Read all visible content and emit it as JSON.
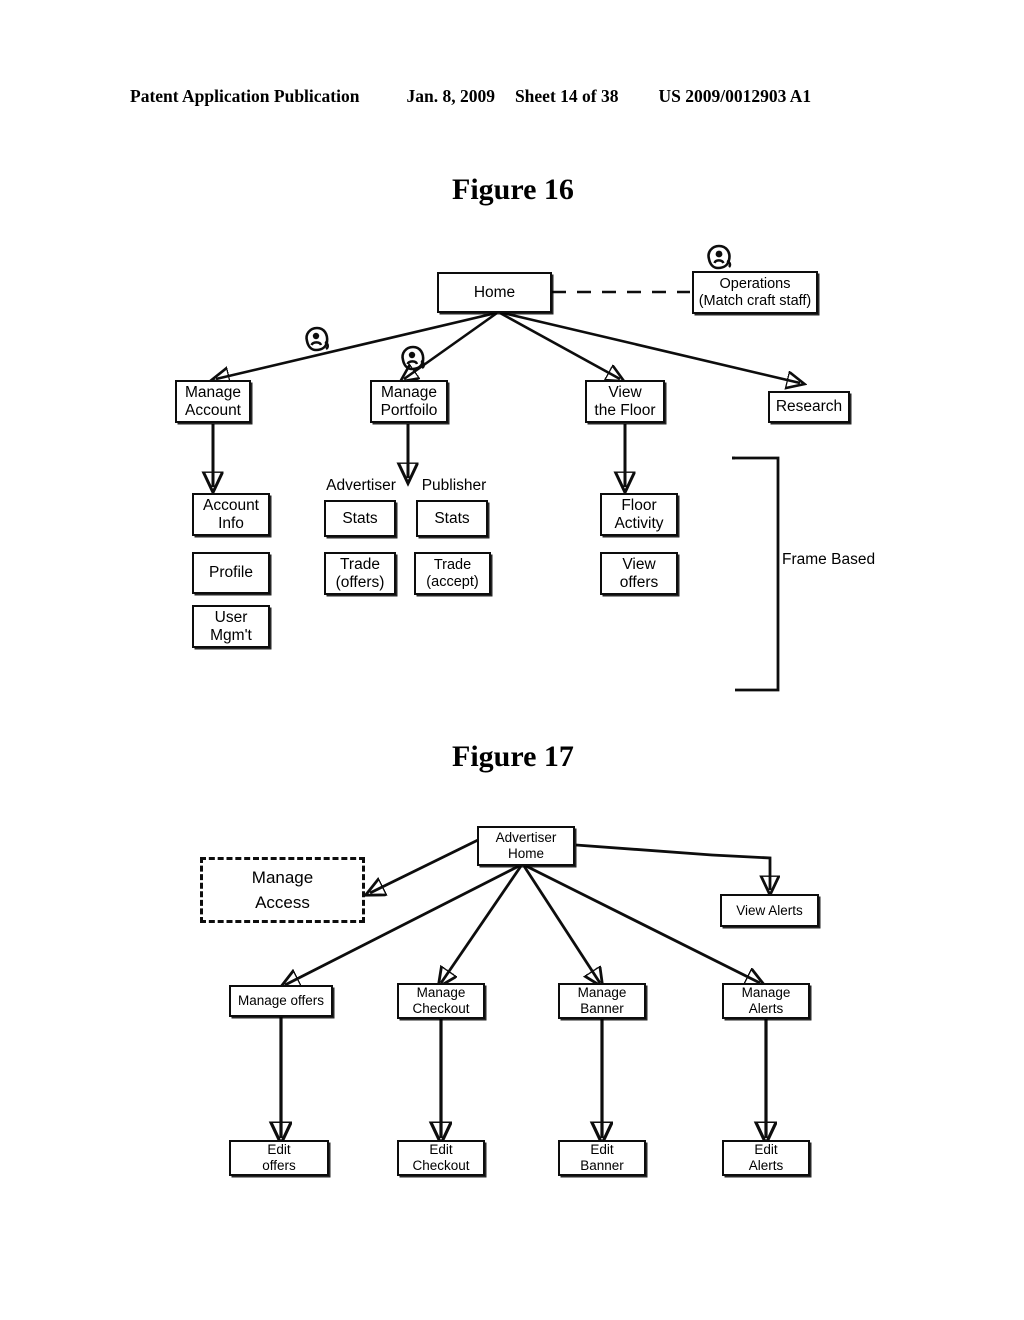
{
  "header": {
    "publication": "Patent Application Publication",
    "date": "Jan. 8, 2009",
    "sheet": "Sheet 14 of 38",
    "patent_number": "US 2009/0012903 A1"
  },
  "figures": [
    {
      "caption": "Figure 16",
      "nodes": {
        "home": "Home",
        "operations_line1": "Operations",
        "operations_line2": "(Match craft staff)",
        "manage_account_line1": "Manage",
        "manage_account_line2": "Account",
        "manage_portfolio_line1": "Manage",
        "manage_portfolio_line2": "Portfoilo",
        "view_the_floor_line1": "View",
        "view_the_floor_line2": "the Floor",
        "research": "Research",
        "account_info_line1": "Account",
        "account_info_line2": "Info",
        "profile": "Profile",
        "user_mgmt_line1": "User",
        "user_mgmt_line2": "Mgm't",
        "advertiser_label": "Advertiser",
        "publisher_label": "Publisher",
        "advertiser_stats": "Stats",
        "publisher_stats": "Stats",
        "trade_offers_line1": "Trade",
        "trade_offers_line2": "(offers)",
        "trade_accept_line1": "Trade",
        "trade_accept_line2": "(accept)",
        "floor_activity_line1": "Floor",
        "floor_activity_line2": "Activity",
        "view_offers_line1": "View",
        "view_offers_line2": "offers",
        "frame_based_line1": "Frame",
        "frame_based_line2": "Based"
      }
    },
    {
      "caption": "Figure 17",
      "nodes": {
        "advertiser_home_line1": "Advertiser",
        "advertiser_home_line2": "Home",
        "manage_access_line1": "Manage",
        "manage_access_line2": "Access",
        "view_alerts": "View Alerts",
        "manage_offers": "Manage offers",
        "manage_checkout_line1": "Manage",
        "manage_checkout_line2": "Checkout",
        "manage_banner_line1": "Manage",
        "manage_banner_line2": "Banner",
        "manage_alerts_line1": "Manage",
        "manage_alerts_line2": "Alerts",
        "edit_offers_line1": "Edit",
        "edit_offers_line2": "offers",
        "edit_checkout_line1": "Edit",
        "edit_checkout_line2": "Checkout",
        "edit_banner_line1": "Edit",
        "edit_banner_line2": "Banner",
        "edit_alerts_line1": "Edit",
        "edit_alerts_line2": "Alerts"
      }
    }
  ],
  "icons": {
    "actor_operations": "actor-icon",
    "actor_manage_account": "actor-icon",
    "actor_manage_portfolio": "actor-icon"
  },
  "colors": {
    "ink": "#0d0d0d",
    "paper": "#ffffff"
  }
}
